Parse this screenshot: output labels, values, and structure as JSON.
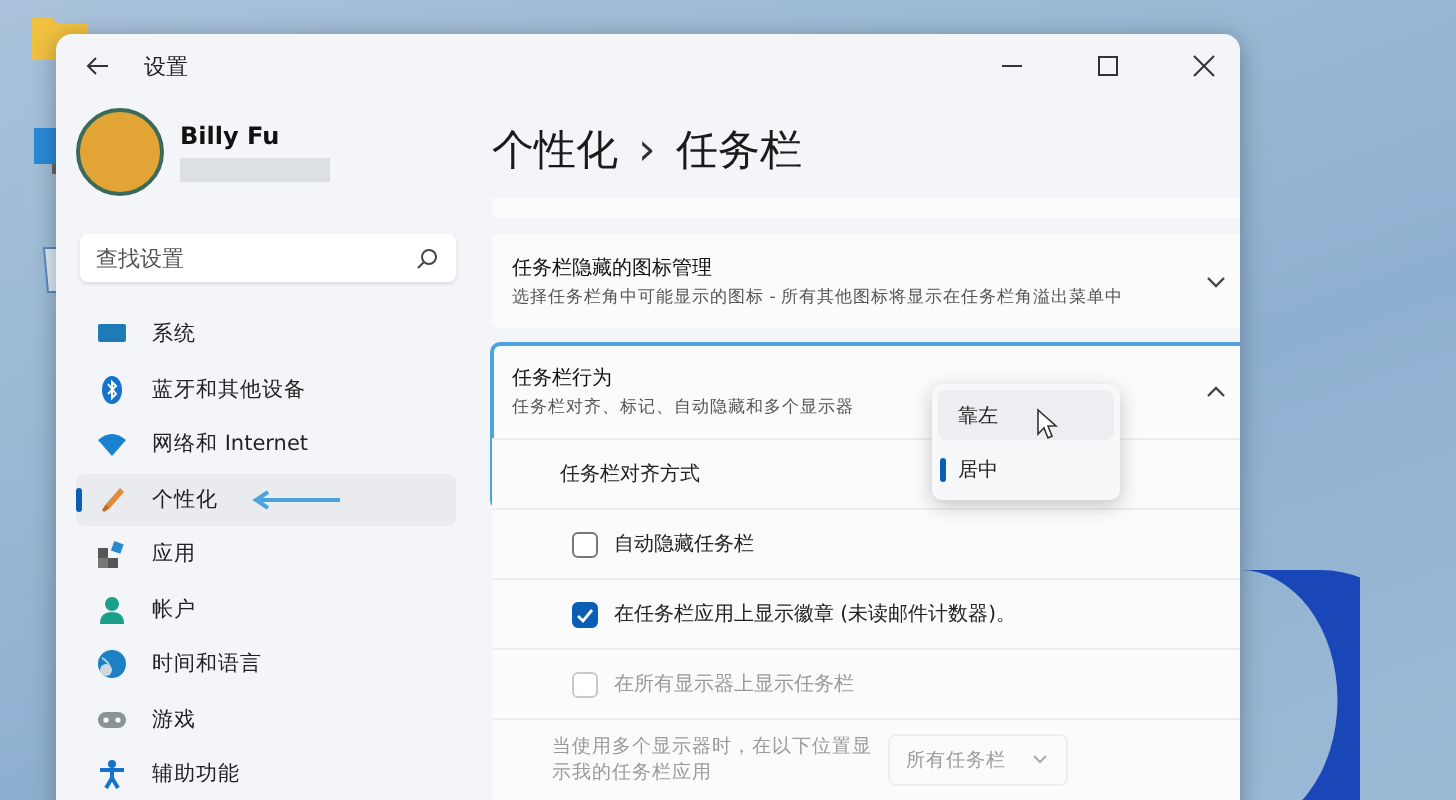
{
  "window": {
    "title": "设置"
  },
  "user": {
    "name": "Billy Fu"
  },
  "search": {
    "placeholder": "查找设置"
  },
  "nav": [
    {
      "label": "系统",
      "selected": false
    },
    {
      "label": "蓝牙和其他设备",
      "selected": false
    },
    {
      "label": "网络和 Internet",
      "selected": false
    },
    {
      "label": "个性化",
      "selected": true
    },
    {
      "label": "应用",
      "selected": false
    },
    {
      "label": "帐户",
      "selected": false
    },
    {
      "label": "时间和语言",
      "selected": false
    },
    {
      "label": "游戏",
      "selected": false
    },
    {
      "label": "辅助功能",
      "selected": false
    }
  ],
  "breadcrumb": {
    "parent": "个性化",
    "separator": "›",
    "current": "任务栏"
  },
  "cards": [
    {
      "title": "任务栏隐藏的图标管理",
      "subtitle": "选择任务栏角中可能显示的图标 - 所有其他图标将显示在任务栏角溢出菜单中",
      "expanded": false
    },
    {
      "title": "任务栏行为",
      "subtitle": "任务栏对齐、标记、自动隐藏和多个显示器",
      "expanded": true,
      "rows": [
        {
          "kind": "dropdown",
          "label": "任务栏对齐方式",
          "options": [
            {
              "label": "靠左",
              "selected": false
            },
            {
              "label": "居中",
              "selected": true
            }
          ]
        },
        {
          "kind": "checkbox",
          "label": "自动隐藏任务栏",
          "checked": false,
          "disabled": false
        },
        {
          "kind": "checkbox",
          "label": "在任务栏应用上显示徽章 (未读邮件计数器)。",
          "checked": true,
          "disabled": false
        },
        {
          "kind": "checkbox",
          "label": "在所有显示器上显示任务栏",
          "checked": false,
          "disabled": true
        },
        {
          "kind": "select",
          "label": "当使用多个显示器时，在以下位置显示我的任务栏应用",
          "value": "所有任务栏",
          "disabled": true
        }
      ]
    }
  ]
}
